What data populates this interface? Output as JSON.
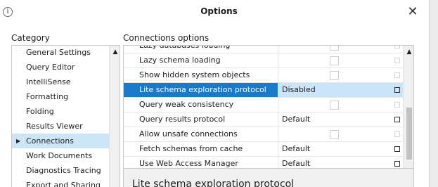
{
  "window": {
    "title": "Options",
    "close_glyph": "✕",
    "info_glyph": "i"
  },
  "category": {
    "heading": "Category",
    "items": [
      {
        "label": "General Settings",
        "selected": false
      },
      {
        "label": "Query Editor",
        "selected": false
      },
      {
        "label": "IntelliSense",
        "selected": false
      },
      {
        "label": "Formatting",
        "selected": false
      },
      {
        "label": "Folding",
        "selected": false
      },
      {
        "label": "Results Viewer",
        "selected": false
      },
      {
        "label": "Connections",
        "selected": true
      },
      {
        "label": "Work Documents",
        "selected": false
      },
      {
        "label": "Diagnostics Tracing",
        "selected": false
      },
      {
        "label": "Export and Sharing",
        "selected": false
      }
    ]
  },
  "connections": {
    "heading": "Connections options",
    "rows": [
      {
        "name": "Lazy databases loading",
        "value": "",
        "checkbox": true,
        "selected": false
      },
      {
        "name": "Lazy schema loading",
        "value": "",
        "checkbox": true,
        "selected": false
      },
      {
        "name": "Show hidden system objects",
        "value": "",
        "checkbox": true,
        "selected": false
      },
      {
        "name": "Lite schema exploration protocol",
        "value": "Disabled",
        "checkbox": false,
        "selected": true
      },
      {
        "name": "Query weak consistency",
        "value": "",
        "checkbox": true,
        "selected": false
      },
      {
        "name": "Query results protocol",
        "value": "Default",
        "checkbox": false,
        "selected": false
      },
      {
        "name": "Allow unsafe connections",
        "value": "",
        "checkbox": true,
        "selected": false
      },
      {
        "name": "Fetch schemas from cache",
        "value": "Default",
        "checkbox": false,
        "selected": false
      },
      {
        "name": "Use Web Access Manager",
        "value": "Default",
        "checkbox": false,
        "selected": false
      }
    ]
  },
  "description": {
    "title": "Lite schema exploration protocol"
  },
  "colors": {
    "selection_blue": "#1979ca",
    "selection_light": "#cce4f7",
    "category_selected": "#cde6f7"
  }
}
